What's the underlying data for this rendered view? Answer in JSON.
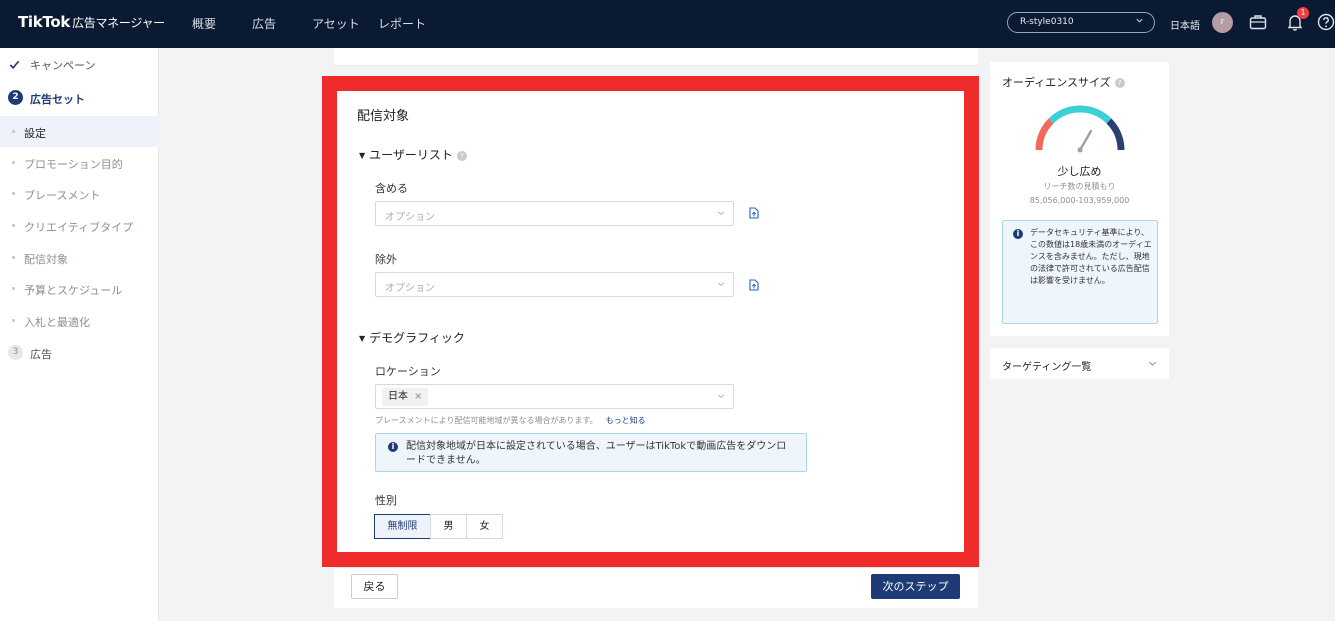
{
  "topbar": {
    "logo": "TikTok",
    "logo_sub": "広告マネージャー",
    "nav": [
      "概要",
      "広告",
      "アセット",
      "レポート"
    ],
    "account": "R-style0310",
    "language": "日本語",
    "avatar_initial": "r",
    "notification_count": "1"
  },
  "sidebar": {
    "campaign": "キャンペーン",
    "adset_step": "2",
    "adset": "広告セット",
    "subitems": [
      "設定",
      "プロモーション目的",
      "プレースメント",
      "クリエイティブタイプ",
      "配信対象",
      "予算とスケジュール",
      "入札と最適化"
    ],
    "ad_step": "3",
    "ad": "広告"
  },
  "targeting": {
    "title": "配信対象",
    "user_list": {
      "heading": "ユーザーリスト",
      "include_label": "含める",
      "include_placeholder": "オプション",
      "exclude_label": "除外",
      "exclude_placeholder": "オプション"
    },
    "demographics": {
      "heading": "デモグラフィック",
      "location_label": "ロケーション",
      "location_tag": "日本",
      "hint": "プレースメントにより配信可能地域が異なる場合があります。",
      "hint_link": "もっと知る",
      "info": "配信対象地域が日本に設定されている場合、ユーザーはTikTokで動画広告をダウンロードできません。",
      "gender_label": "性別",
      "gender_options": [
        "無制限",
        "男",
        "女"
      ]
    }
  },
  "footer": {
    "back": "戻る",
    "next": "次のステップ"
  },
  "audience": {
    "title": "オーディエンスサイズ",
    "level": "少し広め",
    "reach_label": "リーチ数の見積もり",
    "reach_range": "85,056,000-103,959,000",
    "info": "データセキュリティ基準により、この数値は18歳未満のオーディエンスを含みません。ただし、現地の法律で許可されている広告配信は影響を受けません。"
  },
  "targeting_summary": "ターゲティング一覧",
  "colors": {
    "nav_bg": "#0b1a33",
    "primary": "#1f3b76",
    "highlight_frame": "#ef2b2b",
    "info_bg": "#eef6fc"
  }
}
